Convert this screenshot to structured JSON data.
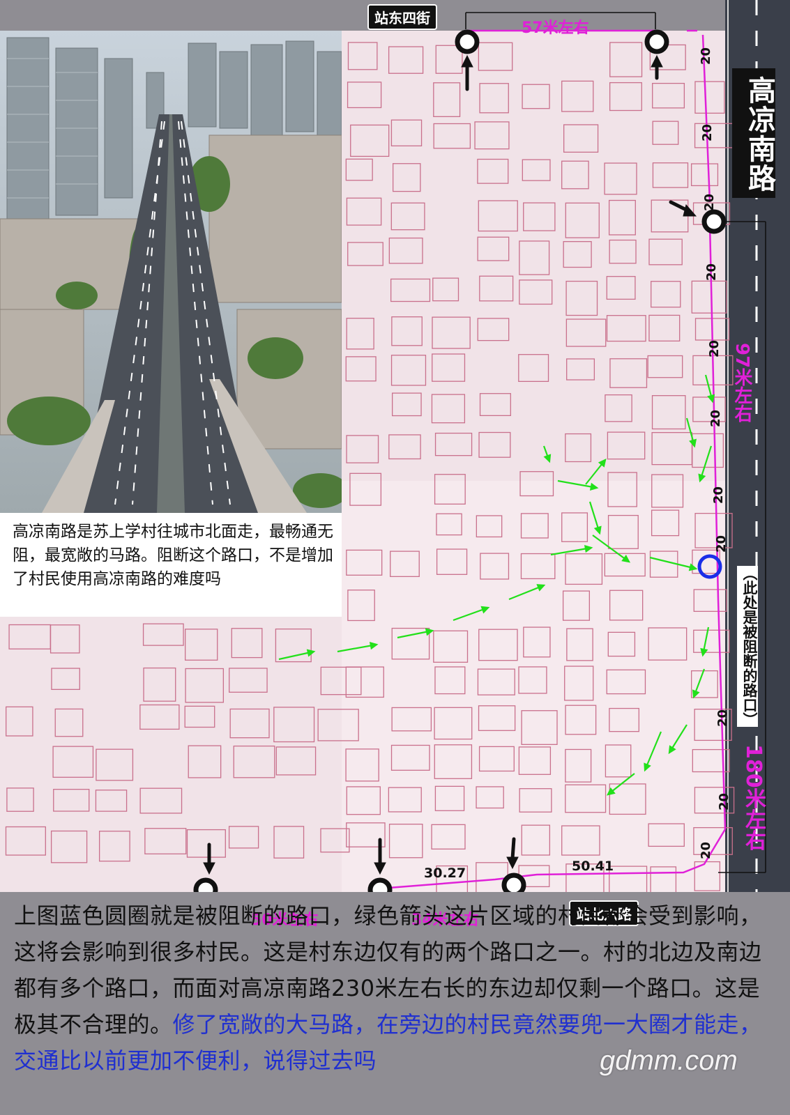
{
  "labels": {
    "street_north": "站东四街",
    "street_south": "站北六路",
    "road_name": "高凉南路",
    "blocked_note": "（此处是被阻断的路口）"
  },
  "distances": {
    "top": "57米左右",
    "right_upper": "97米左右",
    "right_lower": "180米左右",
    "bottom_left": "50米左右",
    "bottom_right": "34米左右",
    "measure_a": "30.27",
    "measure_b": "50.41",
    "road_width": "20"
  },
  "photo_caption": "高凉南路是苏上学村往城市北面走，最畅通无阻，最宽敞的马路。阻断这个路口，不是增加了村民使用高凉南路的难度吗",
  "main_text": {
    "part1": "上图蓝色圆圈就是被阻断的路口，绿色箭头这片区域的村民都会受到影响，这将会影响到很多村民。这是村东边仅有的两个路口之一。村的北边及南边都有多个路口，而面对高凉南路230米左右长的东边却仅剩一个路口。这是极其不合理的。",
    "part2": "修了宽敞的大马路，在旁边的村民竟然要兜一大圈才能走，交通比以前更加不便利，说得过去吗"
  },
  "watermark": "gdmm.com",
  "colors": {
    "magenta": "#e020d8",
    "green_arrow": "#22e01a",
    "blue_circle": "#1a2ee8",
    "road_dark": "#3a3f4a",
    "map_bg": "#f1e3e8"
  }
}
